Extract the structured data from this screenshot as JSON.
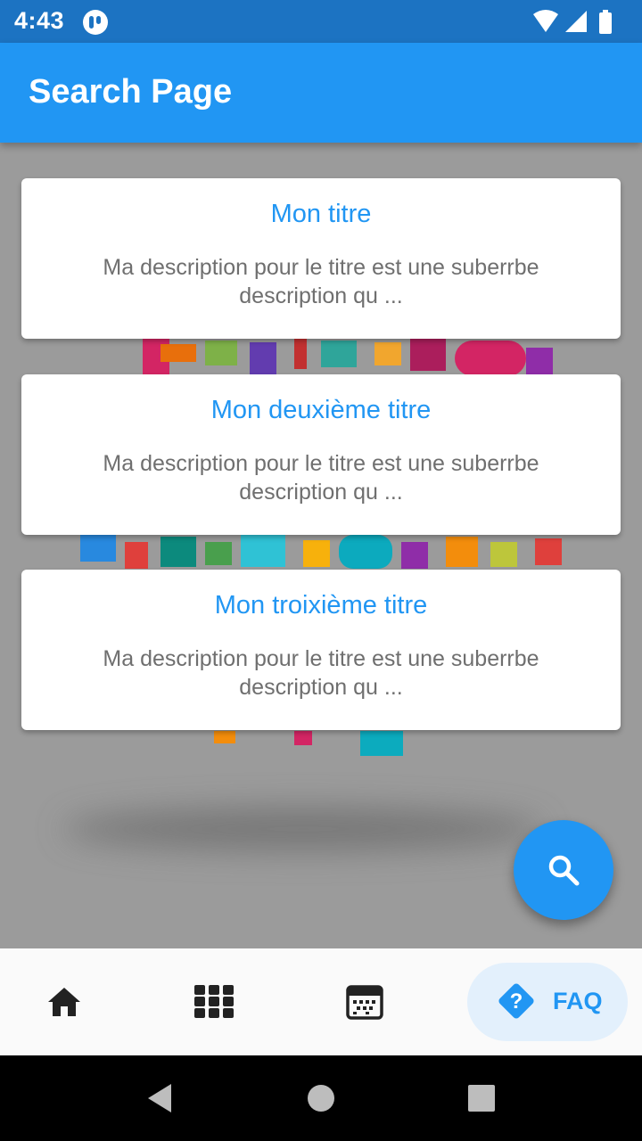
{
  "status_bar": {
    "time": "4:43"
  },
  "app_bar": {
    "title": "Search Page"
  },
  "cards": [
    {
      "title": "Mon titre",
      "description": "Ma description pour le titre est une suberrbe description qu ..."
    },
    {
      "title": "Mon deuxième titre",
      "description": "Ma description pour le titre est une suberrbe description qu ..."
    },
    {
      "title": "Mon troixième titre",
      "description": "Ma description pour le titre est une suberrbe description qu ..."
    }
  ],
  "fab": {
    "icon": "search-icon"
  },
  "bottom_nav": {
    "items": [
      {
        "icon": "home-icon",
        "label": "",
        "active": false
      },
      {
        "icon": "grid-icon",
        "label": "",
        "active": false
      },
      {
        "icon": "calendar-icon",
        "label": "",
        "active": false
      },
      {
        "icon": "help-diamond-icon",
        "label": "FAQ",
        "active": true
      }
    ]
  },
  "colors": {
    "primary": "#2196f3",
    "status_bar": "#1c73c2",
    "active_nav_bg": "#e3f0fc",
    "description_text": "#6f6f6f"
  }
}
